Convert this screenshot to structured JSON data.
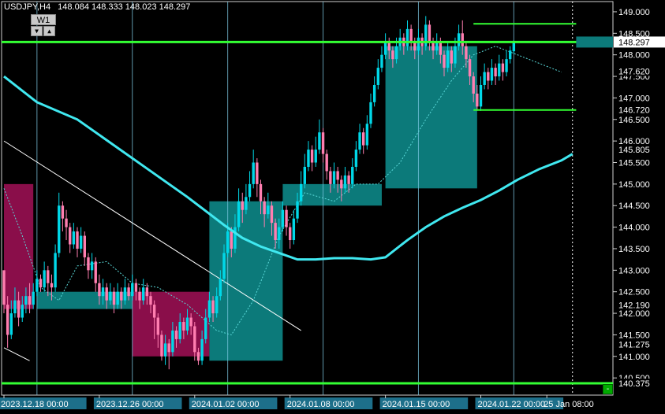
{
  "header": {
    "symbol": "USDJPY,H4",
    "ohlc": "148.084 148.333 148.023 148.297"
  },
  "timeframe": {
    "label": "W1",
    "down_glyph": "▼",
    "up_glyph": "▲"
  },
  "close_button": "-",
  "colors": {
    "background": "#000000",
    "grid": "#7ec8e3",
    "bull": "#00d8e8",
    "bear": "#ff7eb0",
    "ma": "#40e8f0",
    "level": "#33ff33",
    "box_teal": "#0c7a7a",
    "box_maroon": "#8a0e4a",
    "axis_text": "#ffffff"
  },
  "chart_data": {
    "type": "candlestick",
    "symbol": "USDJPY",
    "timeframe": "H4",
    "ylim": [
      140.375,
      149.2
    ],
    "y_ticks": [
      149.0,
      148.5,
      148.0,
      147.5,
      147.0,
      146.5,
      146.0,
      145.5,
      145.0,
      144.5,
      144.0,
      143.5,
      143.0,
      142.5,
      142.0,
      141.5,
      141.0,
      140.5
    ],
    "y_tick_labels": [
      "149.000",
      "148.500",
      "148.000",
      "147.500",
      "147.000",
      "146.500",
      "146.000",
      "145.500",
      "145.000",
      "144.500",
      "144.000",
      "143.500",
      "143.000",
      "142.500",
      "142.000",
      "141.500",
      "141.000",
      "140.500"
    ],
    "price_tags": [
      {
        "label": "148.297",
        "value": 148.297,
        "style": "current"
      },
      {
        "label": "147.620",
        "value": 147.62,
        "style": "plain"
      },
      {
        "label": "146.720",
        "value": 146.72,
        "style": "plain"
      },
      {
        "label": "145.805",
        "value": 145.805,
        "style": "plain"
      },
      {
        "label": "142.190",
        "value": 142.19,
        "style": "plain"
      },
      {
        "label": "141.275",
        "value": 141.275,
        "style": "plain"
      },
      {
        "label": "140.375",
        "value": 140.375,
        "style": "plain"
      }
    ],
    "x_labels": [
      "2023.12.18 00:00",
      "2023.12.26 00:00",
      "2024.01.02 00:00",
      "2024.01.08 00:00",
      "2024.01.15 00:00",
      "2024.01.22 00:00",
      "25 Jan 08:00"
    ],
    "x_label_bars": [
      0,
      26,
      52,
      78,
      104,
      130,
      148
    ],
    "x_label_highlighted": [
      true,
      true,
      true,
      true,
      true,
      true,
      false
    ],
    "vertical_separators_bars": [
      9,
      35,
      61,
      87,
      113,
      139
    ],
    "levels": [
      {
        "value": 148.297,
        "from_bar": 0,
        "to_bar": 170
      },
      {
        "value": 140.375,
        "from_bar": 0,
        "to_bar": 170
      }
    ],
    "range_lines": [
      {
        "value": 148.72,
        "from_bar": 128,
        "to_bar": 156
      },
      {
        "value": 146.72,
        "from_bar": 128,
        "to_bar": 156
      },
      {
        "value": 148.297,
        "from_bar": 128,
        "to_bar": 156,
        "style": "maroon"
      }
    ],
    "boxes": [
      {
        "from_bar": 0,
        "to_bar": 8,
        "low": 142.1,
        "high": 145.0,
        "color": "maroon"
      },
      {
        "from_bar": 9,
        "to_bar": 35,
        "low": 142.1,
        "high": 142.5,
        "color": "teal"
      },
      {
        "from_bar": 35,
        "to_bar": 56,
        "low": 141.0,
        "high": 142.5,
        "color": "maroon"
      },
      {
        "from_bar": 56,
        "to_bar": 76,
        "low": 140.9,
        "high": 144.6,
        "color": "teal"
      },
      {
        "from_bar": 76,
        "to_bar": 103,
        "low": 144.5,
        "high": 145.0,
        "color": "teal"
      },
      {
        "from_bar": 104,
        "to_bar": 129,
        "low": 144.9,
        "high": 148.2,
        "color": "teal"
      }
    ],
    "trendline": {
      "from": [
        0,
        146.0
      ],
      "to": [
        81,
        141.6
      ]
    },
    "trendline2": {
      "from": [
        0,
        141.2
      ],
      "to": [
        7,
        140.9
      ]
    },
    "ma_slow": [
      [
        0,
        147.5
      ],
      [
        9,
        146.9
      ],
      [
        20,
        146.5
      ],
      [
        30,
        145.9
      ],
      [
        40,
        145.3
      ],
      [
        50,
        144.7
      ],
      [
        60,
        144.05
      ],
      [
        65,
        143.75
      ],
      [
        70,
        143.55
      ],
      [
        75,
        143.4
      ],
      [
        80,
        143.25
      ],
      [
        85,
        143.25
      ],
      [
        90,
        143.28
      ],
      [
        95,
        143.28
      ],
      [
        100,
        143.25
      ],
      [
        104,
        143.3
      ],
      [
        110,
        143.7
      ],
      [
        115,
        144.0
      ],
      [
        120,
        144.25
      ],
      [
        125,
        144.45
      ],
      [
        130,
        144.63
      ],
      [
        135,
        144.85
      ],
      [
        140,
        145.1
      ],
      [
        146,
        145.35
      ],
      [
        152,
        145.55
      ],
      [
        155,
        145.7
      ]
    ],
    "ma_fast_dotted": [
      [
        0,
        144.9
      ],
      [
        5,
        143.8
      ],
      [
        10,
        142.6
      ],
      [
        15,
        142.3
      ],
      [
        20,
        143.1
      ],
      [
        28,
        143.2
      ],
      [
        35,
        142.7
      ],
      [
        42,
        142.6
      ],
      [
        50,
        142.2
      ],
      [
        58,
        141.6
      ],
      [
        62,
        141.5
      ],
      [
        68,
        142.3
      ],
      [
        75,
        143.8
      ],
      [
        82,
        144.8
      ],
      [
        90,
        144.6
      ],
      [
        96,
        145.0
      ],
      [
        102,
        145.0
      ],
      [
        108,
        145.5
      ],
      [
        115,
        146.5
      ],
      [
        122,
        147.4
      ],
      [
        128,
        148.0
      ],
      [
        134,
        148.2
      ],
      [
        140,
        148.0
      ],
      [
        146,
        147.8
      ],
      [
        152,
        147.6
      ]
    ],
    "candles": [
      [
        143.0,
        142.2,
        142.6,
        142.0
      ],
      [
        142.2,
        141.5,
        142.4,
        141.2
      ],
      [
        141.5,
        142.0,
        142.3,
        141.4
      ],
      [
        142.0,
        142.3,
        142.6,
        141.9
      ],
      [
        142.3,
        141.9,
        142.5,
        141.7
      ],
      [
        141.9,
        142.2,
        142.4,
        141.8
      ],
      [
        142.2,
        142.4,
        142.6,
        142.0
      ],
      [
        142.4,
        142.2,
        142.7,
        142.0
      ],
      [
        142.2,
        142.5,
        142.7,
        142.1
      ],
      [
        142.5,
        142.8,
        143.0,
        142.4
      ],
      [
        142.8,
        142.6,
        142.9,
        142.5
      ],
      [
        142.6,
        143.0,
        143.2,
        142.5
      ],
      [
        143.0,
        142.7,
        143.1,
        142.4
      ],
      [
        142.7,
        142.6,
        142.9,
        142.3
      ],
      [
        142.6,
        143.4,
        143.6,
        142.5
      ],
      [
        143.4,
        144.5,
        144.8,
        143.3
      ],
      [
        144.5,
        144.2,
        144.6,
        143.9
      ],
      [
        144.2,
        144.0,
        144.4,
        143.7
      ],
      [
        144.0,
        143.6,
        144.1,
        143.4
      ],
      [
        143.6,
        143.9,
        144.1,
        143.5
      ],
      [
        143.9,
        143.5,
        144.0,
        143.3
      ],
      [
        143.5,
        143.8,
        144.0,
        143.4
      ],
      [
        143.8,
        143.3,
        143.9,
        143.1
      ],
      [
        143.3,
        143.0,
        143.4,
        142.8
      ],
      [
        143.0,
        143.2,
        143.4,
        142.8
      ],
      [
        143.2,
        142.7,
        143.3,
        142.5
      ],
      [
        142.7,
        142.4,
        142.9,
        142.2
      ],
      [
        142.4,
        142.6,
        142.8,
        142.2
      ],
      [
        142.6,
        142.3,
        142.7,
        142.1
      ],
      [
        142.3,
        142.5,
        142.7,
        142.2
      ],
      [
        142.5,
        142.2,
        142.6,
        142.0
      ],
      [
        142.2,
        142.5,
        142.7,
        142.1
      ],
      [
        142.5,
        142.3,
        142.6,
        142.1
      ],
      [
        142.3,
        142.6,
        142.8,
        142.2
      ],
      [
        142.6,
        142.4,
        142.7,
        142.3
      ],
      [
        142.4,
        142.7,
        142.9,
        142.3
      ],
      [
        142.7,
        142.5,
        142.8,
        142.3
      ],
      [
        142.5,
        142.3,
        142.6,
        142.1
      ],
      [
        142.3,
        142.6,
        142.8,
        142.2
      ],
      [
        142.6,
        142.4,
        142.7,
        142.2
      ],
      [
        142.4,
        142.2,
        142.5,
        142.0
      ],
      [
        142.2,
        141.9,
        142.3,
        141.4
      ],
      [
        141.9,
        141.5,
        142.0,
        141.2
      ],
      [
        141.5,
        141.0,
        141.6,
        140.9
      ],
      [
        141.0,
        141.3,
        141.5,
        140.8
      ],
      [
        141.3,
        141.1,
        141.4,
        140.7
      ],
      [
        141.1,
        141.6,
        141.8,
        141.0
      ],
      [
        141.6,
        141.4,
        141.7,
        141.2
      ],
      [
        141.4,
        141.8,
        142.0,
        141.3
      ],
      [
        141.8,
        141.6,
        141.9,
        141.4
      ],
      [
        141.6,
        141.9,
        142.1,
        141.5
      ],
      [
        141.9,
        141.7,
        142.0,
        141.5
      ],
      [
        141.7,
        141.1,
        141.8,
        140.9
      ],
      [
        141.1,
        140.9,
        141.2,
        140.8
      ],
      [
        140.9,
        141.4,
        141.6,
        140.8
      ],
      [
        141.4,
        141.9,
        142.1,
        141.3
      ],
      [
        141.9,
        142.3,
        142.5,
        141.8
      ],
      [
        142.3,
        142.0,
        142.4,
        141.8
      ],
      [
        142.0,
        142.4,
        142.6,
        141.9
      ],
      [
        142.4,
        142.8,
        143.0,
        142.3
      ],
      [
        142.8,
        143.4,
        143.6,
        142.7
      ],
      [
        143.4,
        143.9,
        144.1,
        143.3
      ],
      [
        143.9,
        143.5,
        144.0,
        143.3
      ],
      [
        143.5,
        144.0,
        144.3,
        143.4
      ],
      [
        144.0,
        144.6,
        144.9,
        143.9
      ],
      [
        144.6,
        144.4,
        144.8,
        144.1
      ],
      [
        144.4,
        144.7,
        145.0,
        144.3
      ],
      [
        144.7,
        145.0,
        145.3,
        144.6
      ],
      [
        145.0,
        145.5,
        145.8,
        144.9
      ],
      [
        145.5,
        145.0,
        145.6,
        144.7
      ],
      [
        145.0,
        144.6,
        145.1,
        144.3
      ],
      [
        144.6,
        144.3,
        144.7,
        144.0
      ],
      [
        144.3,
        144.5,
        144.8,
        144.2
      ],
      [
        144.5,
        144.1,
        144.6,
        143.8
      ],
      [
        144.1,
        143.7,
        144.2,
        143.5
      ],
      [
        143.7,
        144.0,
        144.2,
        143.5
      ],
      [
        144.0,
        144.4,
        144.6,
        143.9
      ],
      [
        144.4,
        144.0,
        144.5,
        143.8
      ],
      [
        144.0,
        143.7,
        144.1,
        143.5
      ],
      [
        143.7,
        144.2,
        144.4,
        143.6
      ],
      [
        144.2,
        144.6,
        144.8,
        144.1
      ],
      [
        144.6,
        145.0,
        145.3,
        144.5
      ],
      [
        145.0,
        145.4,
        145.7,
        144.9
      ],
      [
        145.4,
        145.8,
        146.0,
        145.3
      ],
      [
        145.8,
        145.5,
        145.9,
        145.3
      ],
      [
        145.5,
        145.8,
        146.1,
        145.4
      ],
      [
        145.8,
        146.2,
        146.5,
        145.7
      ],
      [
        146.2,
        145.7,
        146.3,
        145.5
      ],
      [
        145.7,
        145.3,
        145.8,
        145.1
      ],
      [
        145.3,
        145.0,
        145.4,
        144.8
      ],
      [
        145.0,
        145.3,
        145.5,
        144.9
      ],
      [
        145.3,
        145.1,
        145.4,
        144.8
      ],
      [
        145.1,
        144.9,
        145.2,
        144.6
      ],
      [
        144.9,
        145.2,
        145.4,
        144.8
      ],
      [
        145.2,
        145.0,
        145.3,
        144.8
      ],
      [
        145.0,
        145.4,
        145.6,
        144.9
      ],
      [
        145.4,
        145.8,
        146.0,
        145.3
      ],
      [
        145.8,
        146.2,
        146.4,
        145.7
      ],
      [
        146.2,
        145.9,
        146.3,
        145.7
      ],
      [
        145.9,
        146.4,
        146.6,
        145.8
      ],
      [
        146.4,
        146.9,
        147.1,
        146.3
      ],
      [
        146.9,
        147.3,
        147.5,
        146.8
      ],
      [
        147.3,
        147.7,
        147.9,
        147.2
      ],
      [
        147.7,
        148.0,
        148.2,
        147.6
      ],
      [
        148.0,
        148.3,
        148.5,
        147.9
      ],
      [
        148.3,
        148.1,
        148.4,
        147.9
      ],
      [
        148.1,
        147.9,
        148.2,
        147.7
      ],
      [
        147.9,
        148.2,
        148.4,
        147.8
      ],
      [
        148.2,
        148.4,
        148.6,
        148.1
      ],
      [
        148.4,
        148.2,
        148.5,
        148.0
      ],
      [
        148.2,
        148.6,
        148.8,
        148.1
      ],
      [
        148.6,
        148.3,
        148.7,
        148.1
      ],
      [
        148.3,
        148.1,
        148.4,
        147.9
      ],
      [
        148.1,
        148.4,
        148.6,
        148.0
      ],
      [
        148.4,
        148.2,
        148.5,
        148.0
      ],
      [
        148.2,
        148.7,
        148.9,
        148.1
      ],
      [
        148.7,
        148.3,
        148.8,
        148.1
      ],
      [
        148.3,
        148.1,
        148.4,
        147.9
      ],
      [
        148.1,
        148.3,
        148.5,
        148.0
      ],
      [
        148.3,
        148.0,
        148.4,
        147.8
      ],
      [
        148.0,
        147.7,
        148.1,
        147.5
      ],
      [
        147.7,
        148.1,
        148.3,
        147.6
      ],
      [
        148.1,
        147.8,
        148.2,
        147.6
      ],
      [
        147.8,
        148.2,
        148.4,
        147.7
      ],
      [
        148.2,
        148.5,
        148.7,
        148.1
      ],
      [
        148.5,
        148.2,
        148.8,
        148.0
      ],
      [
        148.2,
        147.9,
        148.3,
        147.7
      ],
      [
        147.9,
        147.5,
        148.0,
        147.3
      ],
      [
        147.5,
        147.1,
        147.6,
        146.9
      ],
      [
        147.1,
        146.8,
        147.3,
        146.7
      ],
      [
        146.8,
        147.3,
        147.5,
        146.7
      ],
      [
        147.3,
        147.6,
        147.8,
        147.2
      ],
      [
        147.6,
        147.4,
        147.7,
        147.2
      ],
      [
        147.4,
        147.7,
        147.9,
        147.3
      ],
      [
        147.7,
        147.5,
        147.8,
        147.3
      ],
      [
        147.5,
        147.8,
        148.0,
        147.4
      ],
      [
        147.8,
        147.6,
        147.9,
        147.4
      ],
      [
        147.6,
        147.9,
        148.1,
        147.5
      ],
      [
        147.9,
        148.1,
        148.2,
        147.8
      ],
      [
        148.084,
        148.297,
        148.333,
        148.023
      ]
    ]
  }
}
